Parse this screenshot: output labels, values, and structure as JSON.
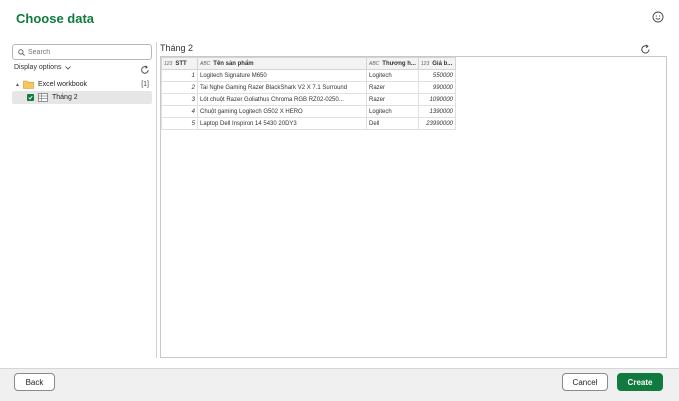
{
  "dialog": {
    "title": "Choose data"
  },
  "navigator": {
    "search_placeholder": "Search",
    "display_options_label": "Display options",
    "tree": {
      "workbook_label": "Excel workbook",
      "workbook_count": "[1]",
      "sheet_label": "Tháng 2",
      "sheet_checked": true
    }
  },
  "preview": {
    "title": "Tháng 2",
    "columns": [
      {
        "type": "123",
        "label": "STT"
      },
      {
        "type": "ABC",
        "label": "Tên sản phẩm"
      },
      {
        "type": "ABC",
        "label": "Thương h..."
      },
      {
        "type": "123",
        "label": "Giá b..."
      }
    ],
    "rows": [
      [
        "1",
        "Logitech Signature M650",
        "Logitech",
        "550000"
      ],
      [
        "2",
        "Tai Nghe Gaming Razer BlackShark V2 X 7.1 Surround",
        "Razer",
        "990000"
      ],
      [
        "3",
        "Lót chuột Razer Goliathus Chroma RGB RZ02-0250...",
        "Razer",
        "1090000"
      ],
      [
        "4",
        "Chuột gaming Logitech G502 X HERO",
        "Logitech",
        "1390000"
      ],
      [
        "5",
        "Laptop Dell Inspiron 14 5430 20DY3",
        "Dell",
        "23990000"
      ]
    ]
  },
  "footer": {
    "back_label": "Back",
    "cancel_label": "Cancel",
    "create_label": "Create"
  },
  "colors": {
    "accent": "#117a3f"
  }
}
